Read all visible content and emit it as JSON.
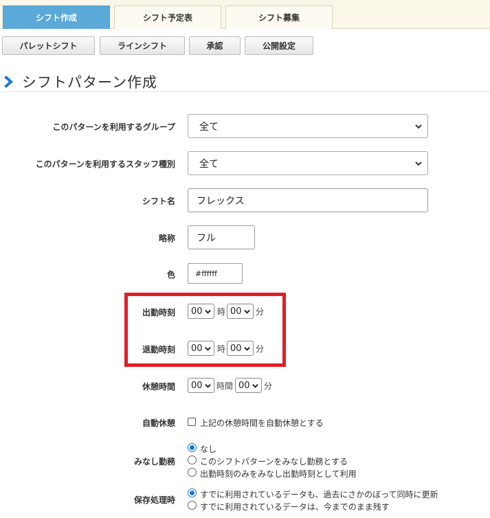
{
  "top_tabs": [
    {
      "label": "シフト作成",
      "active": true
    },
    {
      "label": "シフト予定表",
      "active": false
    },
    {
      "label": "シフト募集",
      "active": false
    }
  ],
  "sub_buttons": [
    "パレットシフト",
    "ラインシフト",
    "承認",
    "公開設定"
  ],
  "section_title": "シフトパターン作成",
  "form": {
    "group": {
      "label": "このパターンを利用するグループ",
      "value": "全て"
    },
    "staff_type": {
      "label": "このパターンを利用するスタッフ種別",
      "value": "全て"
    },
    "shift_name": {
      "label": "シフト名",
      "value": "フレックス"
    },
    "abbreviation": {
      "label": "略称",
      "value": "フル"
    },
    "color": {
      "label": "色",
      "value": "#ffffff"
    },
    "start_time": {
      "label": "出勤時刻",
      "hour": "00",
      "minute": "00",
      "hour_unit": "時",
      "minute_unit": "分"
    },
    "end_time": {
      "label": "退勤時刻",
      "hour": "00",
      "minute": "00",
      "hour_unit": "時",
      "minute_unit": "分"
    },
    "break_time": {
      "label": "休憩時間",
      "hour": "00",
      "minute": "00",
      "hour_unit": "時間",
      "minute_unit": "分"
    },
    "auto_break": {
      "label": "自動休憩",
      "option": "上記の休憩時間を自動休憩とする",
      "checked": false
    },
    "deemed_work": {
      "label": "みなし勤務",
      "options": [
        "なし",
        "このシフトパターンをみなし勤務とする",
        "出勤時刻のみをみなし出勤時刻として利用"
      ],
      "selected": 0
    },
    "save_processing": {
      "label": "保存処理時",
      "options": [
        "すでに利用されているデータも、過去にさかのぼって同時に更新",
        "すでに利用されているデータは、今までのまま残す"
      ],
      "selected": 0
    }
  },
  "colors": {
    "accent": "#5aa9d8",
    "highlight": "#e21e26",
    "radio": "#1a73e8"
  }
}
